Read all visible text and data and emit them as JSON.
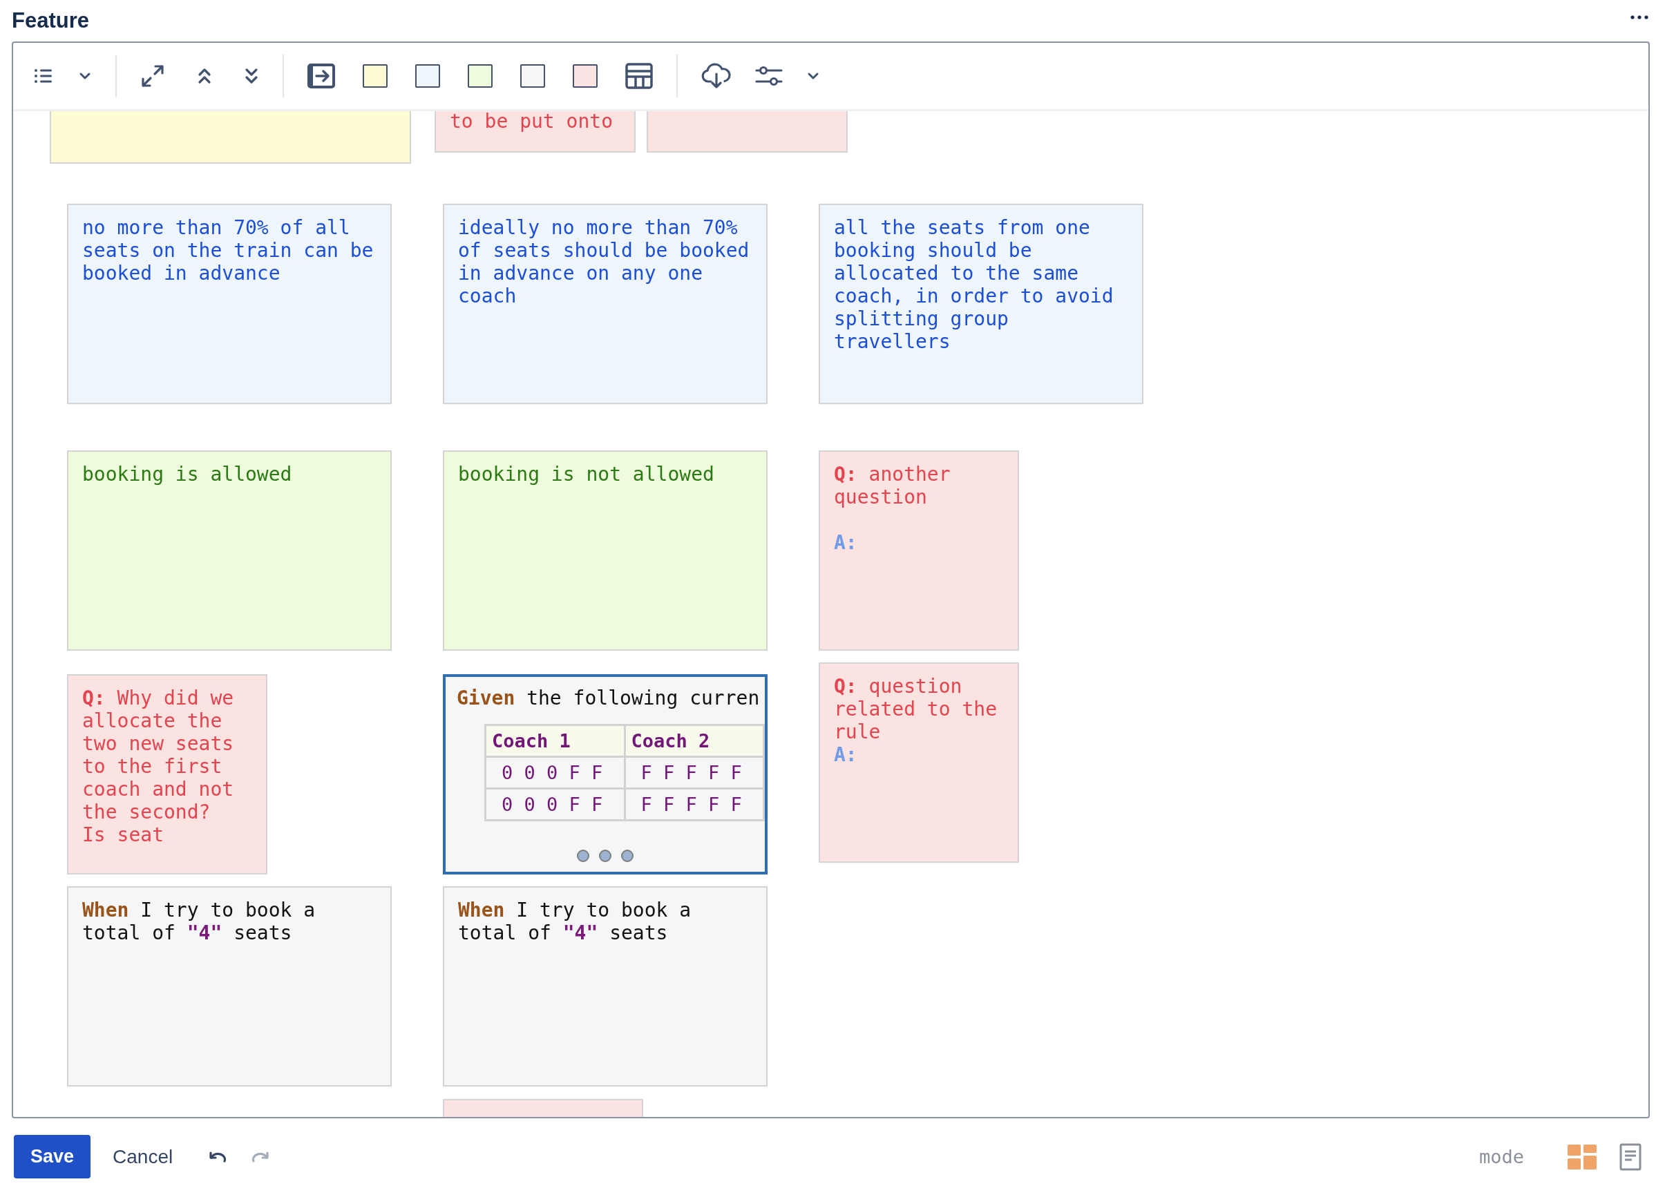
{
  "header": {
    "title": "Feature"
  },
  "toolbar": {
    "swatches": [
      {
        "color": "#fdfbd4"
      },
      {
        "color": "#eef6fc"
      },
      {
        "color": "#eefbdc"
      },
      {
        "color": "#f5f6f8"
      },
      {
        "color": "#fae3e1"
      }
    ]
  },
  "cards": [
    {
      "kind": "yellow"
    },
    {
      "kind": "pink",
      "segments": [
        {
          "kind": "plain",
          "text": "to be put onto"
        }
      ]
    },
    {
      "kind": "pink"
    },
    {
      "kind": "blue",
      "segments": [
        {
          "kind": "plain",
          "text": "no more than 70% of all seats on the train can be booked in advance"
        }
      ]
    },
    {
      "kind": "blue",
      "segments": [
        {
          "kind": "plain",
          "text": "ideally no more than 70% of seats should be booked in advance on any one coach"
        }
      ]
    },
    {
      "kind": "blue",
      "segments": [
        {
          "kind": "plain",
          "text": "all the seats from one booking should be allocated to the same coach, in order to avoid splitting group travellers"
        }
      ]
    },
    {
      "kind": "green",
      "segments": [
        {
          "kind": "plain",
          "text": "booking is allowed"
        }
      ]
    },
    {
      "kind": "green",
      "segments": [
        {
          "kind": "plain",
          "text": "booking is not allowed"
        }
      ]
    },
    {
      "kind": "pink",
      "segments": [
        {
          "kind": "question",
          "text": "Q:"
        },
        {
          "kind": "plain",
          "text": " another question\n\n"
        },
        {
          "kind": "answer",
          "text": "A:"
        }
      ]
    },
    {
      "kind": "pink",
      "segments": [
        {
          "kind": "question",
          "text": "Q:"
        },
        {
          "kind": "plain",
          "text": " Why did we allocate the two new seats to the first coach and not the second?\nIs seat"
        }
      ]
    },
    {
      "kind": "given",
      "segments": [
        {
          "kind": "keyword",
          "text": "Given"
        },
        {
          "kind": "plain",
          "text": " the following curren"
        }
      ],
      "table": {
        "columns": [
          "Coach 1",
          "Coach 2"
        ],
        "rows": [
          [
            "0 0 0 F F",
            "F F F F F"
          ],
          [
            "0 0 0 F F",
            "F F F F F"
          ]
        ]
      }
    },
    {
      "kind": "pink",
      "segments": [
        {
          "kind": "question",
          "text": "Q:"
        },
        {
          "kind": "plain",
          "text": " question related to the rule\n"
        },
        {
          "kind": "answer",
          "text": "A:"
        }
      ]
    },
    {
      "kind": "grey",
      "segments": [
        {
          "kind": "keyword",
          "text": "When"
        },
        {
          "kind": "plain",
          "text": " I try to book a total of "
        },
        {
          "kind": "param",
          "text": "\"4\""
        },
        {
          "kind": "plain",
          "text": " seats"
        }
      ]
    },
    {
      "kind": "grey",
      "segments": [
        {
          "kind": "keyword",
          "text": "When"
        },
        {
          "kind": "plain",
          "text": " I try to book a total of "
        },
        {
          "kind": "param",
          "text": "\"4\""
        },
        {
          "kind": "plain",
          "text": " seats"
        }
      ]
    },
    {
      "kind": "pink"
    }
  ],
  "footer": {
    "save": "Save",
    "cancel": "Cancel",
    "undo": {
      "disabled": false
    },
    "redo": {
      "disabled": true
    },
    "mode_label": "mode",
    "modes": [
      {
        "kind": "board",
        "selected": true
      },
      {
        "kind": "document",
        "selected": false
      }
    ]
  }
}
